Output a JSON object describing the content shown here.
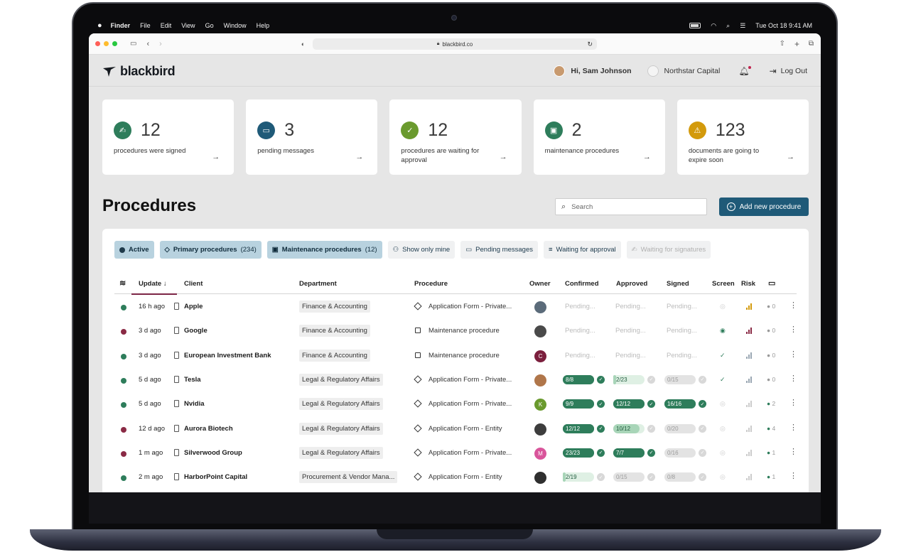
{
  "menubar": {
    "apple": "",
    "items": [
      "Finder",
      "File",
      "Edit",
      "View",
      "Go",
      "Window",
      "Help"
    ],
    "datetime": "Tue Oct 18  9:41 AM"
  },
  "browser": {
    "url": "blackbird.co"
  },
  "header": {
    "logo": "blackbird",
    "greeting": "Hi, Sam Johnson",
    "company": "Northstar Capital",
    "logout": "Log Out"
  },
  "cards": [
    {
      "value": "12",
      "label": "procedures were signed",
      "color": "#2e7d5b",
      "icon": "signature-icon"
    },
    {
      "value": "3",
      "label": "pending messages",
      "color": "#1f5a78",
      "icon": "message-icon"
    },
    {
      "value": "12",
      "label": "procedures are waiting for approval",
      "color": "#6a9a2e",
      "icon": "approval-icon"
    },
    {
      "value": "2",
      "label": "maintenance procedures",
      "color": "#2e7d5b",
      "icon": "calendar-icon"
    },
    {
      "value": "123",
      "label": "documents are going to expire soon",
      "color": "#d39a0c",
      "icon": "warning-icon"
    }
  ],
  "page_title": "Procedures",
  "search": {
    "placeholder": "Search"
  },
  "add_button": "Add new procedure",
  "filters": {
    "active": "Active",
    "primary": "Primary procedures",
    "primary_count": "(234)",
    "maintenance": "Maintenance procedures",
    "maintenance_count": "(12)",
    "mine": "Show only mine",
    "pending": "Pending messages",
    "waiting_approval": "Waiting for approval",
    "waiting_signatures": "Waiting for signatures"
  },
  "columns": {
    "update": "Update ↓",
    "client": "Client",
    "department": "Department",
    "procedure": "Procedure",
    "owner": "Owner",
    "confirmed": "Confirmed",
    "approved": "Approved",
    "signed": "Signed",
    "screen": "Screen",
    "risk": "Risk"
  },
  "rows": [
    {
      "status": "ok",
      "update": "16 h ago",
      "client": "Apple",
      "department": "Finance & Accounting",
      "proc_icon": "diamond",
      "procedure": "Application Form - Private...",
      "owner_color": "#5b6b7a",
      "owner_initial": "",
      "confirmed": "Pending...",
      "approved": "Pending...",
      "signed": "Pending...",
      "risk_color": "#d39a0c",
      "messages": "0"
    },
    {
      "status": "bad",
      "update": "3 d ago",
      "client": "Google",
      "department": "Finance & Accounting",
      "proc_icon": "calendar",
      "procedure": "Maintenance procedure",
      "owner_color": "#4a4a4a",
      "owner_initial": "",
      "confirmed": "Pending...",
      "approved": "Pending...",
      "signed": "Pending...",
      "risk_color": "#8a2a45",
      "messages": "0"
    },
    {
      "status": "ok",
      "update": "3 d ago",
      "client": "European Investment Bank",
      "department": "Finance & Accounting",
      "proc_icon": "calendar",
      "procedure": "Maintenance procedure",
      "owner_color": "#7b1f3d",
      "owner_initial": "C",
      "confirmed": "Pending...",
      "approved": "Pending...",
      "signed": "Pending...",
      "risk_color": "#9aa7b3",
      "messages": "0"
    },
    {
      "status": "ok",
      "update": "5 d ago",
      "client": "Tesla",
      "department": "Legal & Regulatory Affairs",
      "proc_icon": "diamond",
      "procedure": "Application Form - Private...",
      "owner_color": "#b0764a",
      "owner_initial": "",
      "confirmed": "8/8",
      "confirmed_pct": 1,
      "confirmed_ok": true,
      "approved": "2/23",
      "approved_pct": 0.09,
      "approved_ok": false,
      "signed": "0/15",
      "signed_pct": 0,
      "signed_ok": false,
      "risk_color": "#9aa7b3",
      "messages": "0"
    },
    {
      "status": "ok",
      "update": "5 d ago",
      "client": "Nvidia",
      "department": "Legal & Regulatory Affairs",
      "proc_icon": "diamond",
      "procedure": "Application Form - Private...",
      "owner_color": "#6a9a2e",
      "owner_initial": "K",
      "confirmed": "9/9",
      "confirmed_pct": 1,
      "confirmed_ok": true,
      "approved": "12/12",
      "approved_pct": 1,
      "approved_ok": true,
      "signed": "16/16",
      "signed_pct": 1,
      "signed_ok": true,
      "risk_color": "#cccccc",
      "messages": "2",
      "msg_active": true
    },
    {
      "status": "bad",
      "update": "12 d ago",
      "client": "Aurora Biotech",
      "department": "Legal & Regulatory Affairs",
      "proc_icon": "diamond",
      "procedure": "Application Form - Entity",
      "owner_color": "#3d3d3d",
      "owner_initial": "",
      "confirmed": "12/12",
      "confirmed_pct": 1,
      "confirmed_ok": true,
      "approved": "10/12",
      "approved_pct": 0.83,
      "approved_ok": false,
      "signed": "0/20",
      "signed_pct": 0,
      "signed_ok": false,
      "risk_color": "#cccccc",
      "messages": "4",
      "msg_active": true
    },
    {
      "status": "bad",
      "update": "1 m ago",
      "client": "Silverwood Group",
      "department": "Legal & Regulatory Affairs",
      "proc_icon": "diamond",
      "procedure": "Application Form - Private...",
      "owner_color": "#d9559b",
      "owner_initial": "M",
      "confirmed": "23/23",
      "confirmed_pct": 1,
      "confirmed_ok": true,
      "approved": "7/7",
      "approved_pct": 1,
      "approved_ok": true,
      "signed": "0/16",
      "signed_pct": 0,
      "signed_ok": false,
      "risk_color": "#cccccc",
      "messages": "1",
      "msg_active": true
    },
    {
      "status": "ok",
      "update": "2 m ago",
      "client": "HarborPoint Capital",
      "department": "Procurement & Vendor Mana...",
      "proc_icon": "diamond",
      "procedure": "Application Form - Entity",
      "owner_color": "#2f2f2f",
      "owner_initial": "",
      "confirmed": "2/19",
      "confirmed_pct": 0.1,
      "confirmed_ok": false,
      "approved": "0/15",
      "approved_pct": 0,
      "approved_ok": false,
      "signed": "0/8",
      "signed_pct": 0,
      "signed_ok": false,
      "risk_color": "#cccccc",
      "messages": "1",
      "msg_active": true
    }
  ]
}
